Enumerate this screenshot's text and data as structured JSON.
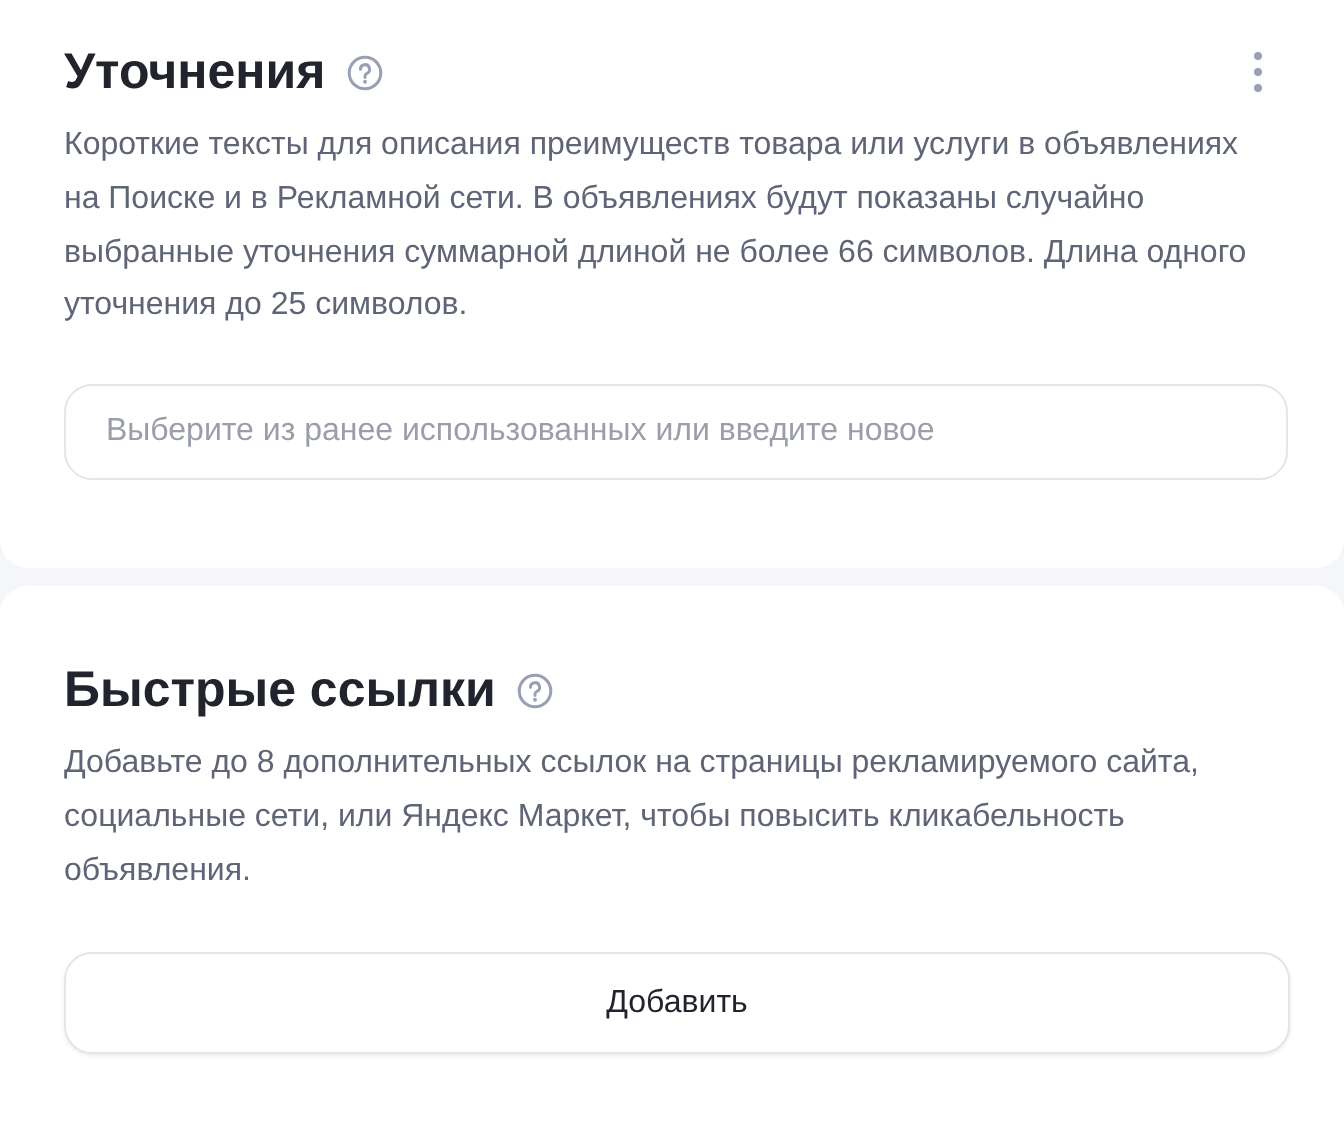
{
  "sections": [
    {
      "title": "Уточнения",
      "help": true,
      "menu": true,
      "description": "Короткие тексты для описания преимуществ товара или услуги в объявлениях на Поиске и в Рекламной сети. В объявлениях будут показаны случайно выбранные уточнения суммарной длиной не более 66 символов. Длина одного уточнения до 25 символов.",
      "control": {
        "kind": "field",
        "placeholder": "Выберите из ранее использованных или введите новое"
      }
    },
    {
      "title": "Быстрые ссылки",
      "help": true,
      "menu": false,
      "description": "Добавьте до 8 дополнительных ссылок на страницы рекламируемого сайта, социальные сети, или Яндекс Маркет, чтобы повысить кликабельность объявления.",
      "control": {
        "kind": "button",
        "label": "Добавить"
      }
    }
  ]
}
